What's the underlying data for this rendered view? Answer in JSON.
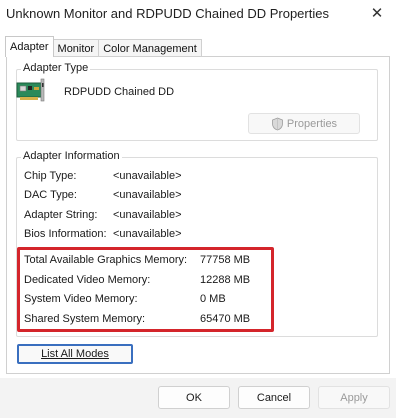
{
  "window": {
    "title": "Unknown Monitor and RDPUDD Chained DD Properties",
    "close_glyph": "✕"
  },
  "tabs": [
    {
      "label": "Adapter",
      "active": true
    },
    {
      "label": "Monitor",
      "active": false
    },
    {
      "label": "Color Management",
      "active": false
    }
  ],
  "adapter_type": {
    "group_title": "Adapter Type",
    "adapter_name": "RDPUDD Chained DD",
    "properties_button": "Properties",
    "properties_icon": "shield-icon"
  },
  "adapter_info": {
    "group_title": "Adapter Information",
    "rows": [
      {
        "label": "Chip Type:",
        "value": "<unavailable>"
      },
      {
        "label": "DAC Type:",
        "value": "<unavailable>"
      },
      {
        "label": "Adapter String:",
        "value": "<unavailable>"
      },
      {
        "label": "Bios Information:",
        "value": "<unavailable>"
      }
    ],
    "memory": [
      {
        "label": "Total Available Graphics Memory:",
        "value": "77758 MB"
      },
      {
        "label": "Dedicated Video Memory:",
        "value": "12288 MB"
      },
      {
        "label": "System Video Memory:",
        "value": "0 MB"
      },
      {
        "label": "Shared System Memory:",
        "value": "65470 MB"
      }
    ],
    "highlight_color": "#d4252b"
  },
  "list_all_modes_button": "List All Modes",
  "footer": {
    "ok_label": "OK",
    "cancel_label": "Cancel",
    "apply_label": "Apply"
  },
  "colors": {
    "focus_border": "#3a6fbf",
    "footer_bg": "#f3f3f3"
  }
}
